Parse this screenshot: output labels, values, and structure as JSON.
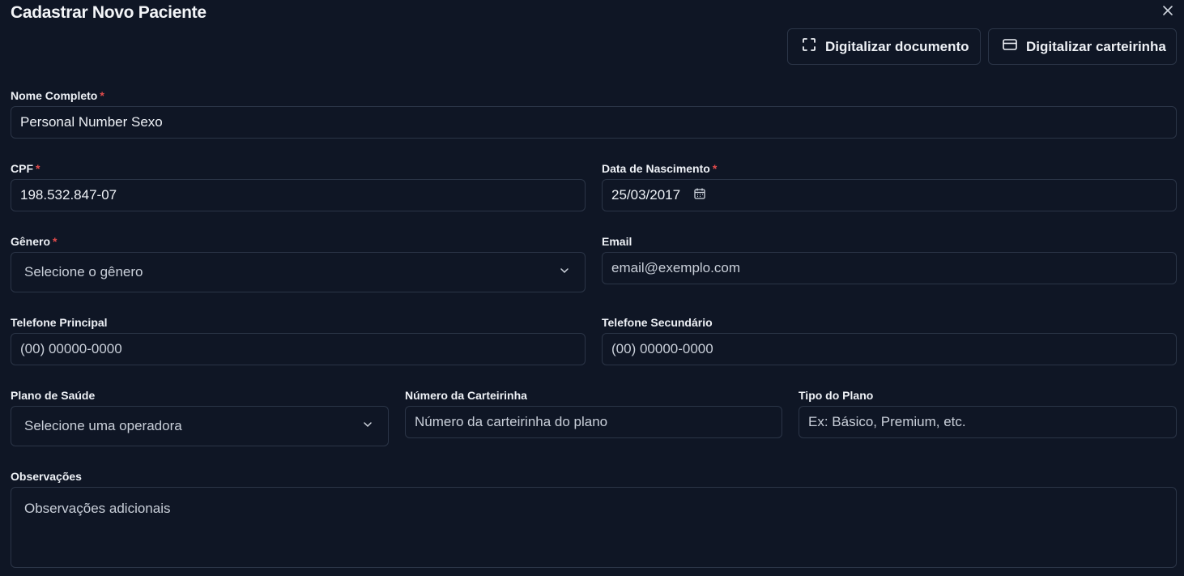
{
  "dialog": {
    "title": "Cadastrar Novo Paciente",
    "close_icon": "close-icon"
  },
  "actions": {
    "scan_document": {
      "label": "Digitalizar documento",
      "icon": "scan-frame-icon"
    },
    "scan_card": {
      "label": "Digitalizar carteirinha",
      "icon": "credit-card-icon"
    }
  },
  "form": {
    "required_mark": "*",
    "nome": {
      "label": "Nome Completo",
      "value": "Personal Number Sexo"
    },
    "cpf": {
      "label": "CPF",
      "value": "198.532.847-07"
    },
    "nascimento": {
      "label": "Data de Nascimento",
      "value": "25/03/2017",
      "icon": "calendar-icon"
    },
    "genero": {
      "label": "Gênero",
      "placeholder": "Selecione o gênero"
    },
    "email": {
      "label": "Email",
      "placeholder": "email@exemplo.com"
    },
    "telefone_principal": {
      "label": "Telefone Principal",
      "placeholder": "(00) 00000-0000"
    },
    "telefone_secundario": {
      "label": "Telefone Secundário",
      "placeholder": "(00) 00000-0000"
    },
    "plano": {
      "label": "Plano de Saúde",
      "placeholder": "Selecione uma operadora"
    },
    "carteirinha": {
      "label": "Número da Carteirinha",
      "placeholder": "Número da carteirinha do plano"
    },
    "tipo_plano": {
      "label": "Tipo do Plano",
      "placeholder": "Ex: Básico, Premium, etc."
    },
    "observacoes": {
      "label": "Observações",
      "placeholder": "Observações adicionais"
    }
  },
  "colors": {
    "background": "#0f1625",
    "border": "#2b3547",
    "required": "#e14b4b",
    "text": "#eef1f6"
  }
}
